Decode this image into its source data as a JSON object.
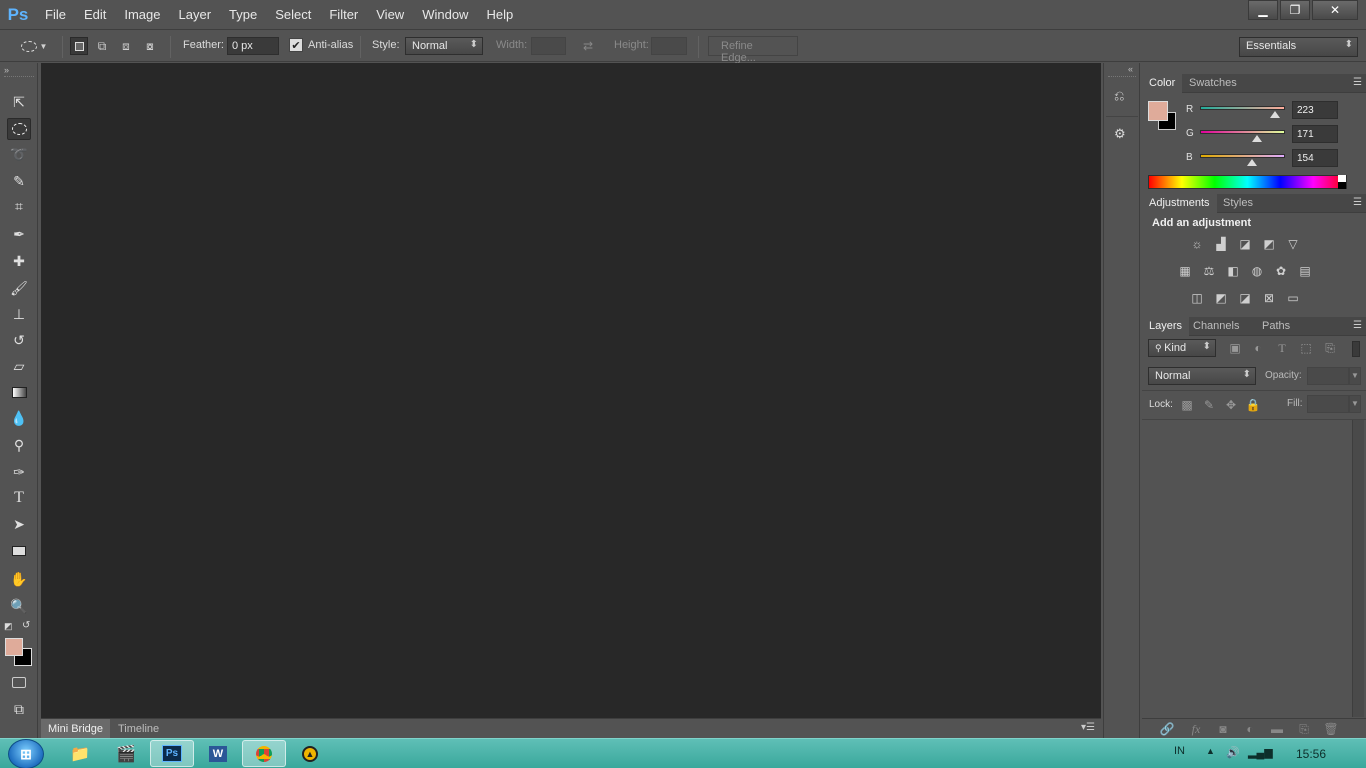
{
  "app": {
    "logo": "Ps",
    "menu": [
      "File",
      "Edit",
      "Image",
      "Layer",
      "Type",
      "Select",
      "Filter",
      "View",
      "Window",
      "Help"
    ],
    "window_controls": [
      "minimize",
      "restore",
      "close"
    ]
  },
  "options_bar": {
    "feather_label": "Feather:",
    "feather_value": "0 px",
    "antialias_label": "Anti-alias",
    "antialias_checked": true,
    "style_label": "Style:",
    "style_value": "Normal",
    "width_label": "Width:",
    "height_label": "Height:",
    "refine_edge_label": "Refine Edge...",
    "workspace_value": "Essentials"
  },
  "tools": [
    "move-tool",
    "elliptical-marquee-tool",
    "lasso-tool",
    "quick-selection-tool",
    "crop-tool",
    "eyedropper-tool",
    "healing-brush-tool",
    "brush-tool",
    "clone-stamp-tool",
    "history-brush-tool",
    "eraser-tool",
    "gradient-tool",
    "blur-tool",
    "dodge-tool",
    "pen-tool",
    "type-tool",
    "path-selection-tool",
    "rectangle-tool",
    "hand-tool",
    "zoom-tool"
  ],
  "colors": {
    "foreground": "#DFAB9A",
    "background": "#000000",
    "accent": "#5eb4ff"
  },
  "bottom_panel": {
    "tabs": [
      "Mini Bridge",
      "Timeline"
    ]
  },
  "color_panel": {
    "tabs": [
      "Color",
      "Swatches"
    ],
    "channels": [
      {
        "label": "R",
        "value": "223"
      },
      {
        "label": "G",
        "value": "171"
      },
      {
        "label": "B",
        "value": "154"
      }
    ]
  },
  "adjustments_panel": {
    "tabs": [
      "Adjustments",
      "Styles"
    ],
    "heading": "Add an adjustment"
  },
  "layers_panel": {
    "tabs": [
      "Layers",
      "Channels",
      "Paths"
    ],
    "filter_kind": "Kind",
    "blend_mode": "Normal",
    "opacity_label": "Opacity:",
    "lock_label": "Lock:",
    "fill_label": "Fill:"
  },
  "taskbar": {
    "language": "IN",
    "clock": "15:56"
  }
}
